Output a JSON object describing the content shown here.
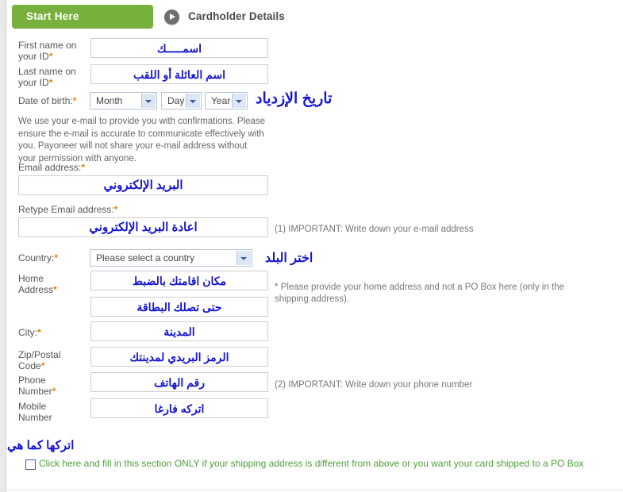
{
  "header": {
    "start_button_label": "Start Here",
    "arrow_icon": "play-arrow-icon",
    "title": "Cardholder Details",
    "green": "#77b03c"
  },
  "form": {
    "first_name": {
      "label": "First name on\nyour ID",
      "required_mark": "*",
      "value": "اسمـــــك"
    },
    "last_name": {
      "label": "Last name on\nyour ID",
      "required_mark": "*",
      "value": "اسم العائلة أو اللقب"
    },
    "date_of_birth": {
      "label": "Date of birth:",
      "required_mark": "*",
      "month_value": "Month",
      "day_value": "Day",
      "year_value": "Year",
      "annotation": "تاريخ الإزدياد"
    },
    "email_paragraph": "We use your e-mail to provide you with confirmations. Please ensure the e-mail is accurate to communicate effectively with you. Payoneer will not share your e-mail address without your permission with anyone.",
    "email": {
      "label": "Email address:",
      "required_mark": "*",
      "value": "البريد الإلكتروني"
    },
    "retype_email": {
      "label": "Retype Email address:",
      "required_mark": "*",
      "value": "اعادة البريد الإلكتروني",
      "note": "(1) IMPORTANT: Write down your e-mail address"
    },
    "country": {
      "label": "Country:",
      "required_mark": "*",
      "value": "Please select a country",
      "annotation": "اختر البلد"
    },
    "home_address": {
      "label": "Home\nAddress",
      "required_mark": "*",
      "value_line1": "مكان اقامتك بالضبط",
      "value_line2": "حتى تصلك البطاقة",
      "note": "* Please provide your home address and not a PO Box here (only in the shipping address)."
    },
    "city": {
      "label": "City:",
      "required_mark": "*",
      "value": "المدينة"
    },
    "zip": {
      "label": "Zip/Postal\nCode",
      "required_mark": "*",
      "value": "الرمز البريدي لمدينتك"
    },
    "phone": {
      "label": "Phone\nNumber",
      "required_mark": "*",
      "value": "رقم الهاتف",
      "note": "(2) IMPORTANT: Write down your phone number"
    },
    "mobile": {
      "label": "Mobile\nNumber",
      "required_mark": "",
      "value": "اتركه فارغا"
    }
  },
  "shipping": {
    "annotation": "اتركها كما هي",
    "checkbox_label": "Click here and fill in this section ONLY if your shipping address is different from above or you want your card shipped to a PO Box",
    "green": "#4fa03c"
  }
}
